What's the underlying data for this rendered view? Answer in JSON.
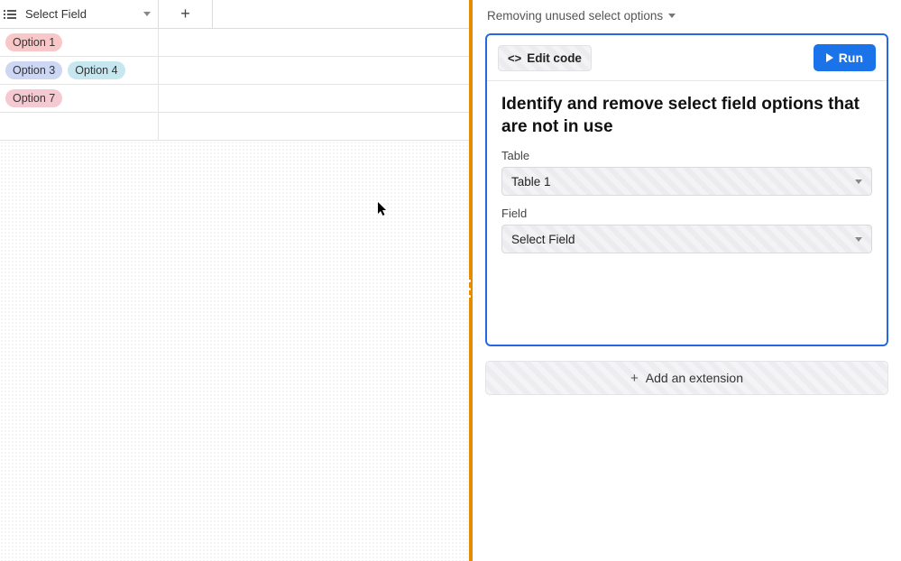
{
  "left": {
    "column_header": "Select Field",
    "rows": [
      {
        "tags": [
          {
            "label": "Option 1",
            "bg": "#f8c7c7"
          }
        ]
      },
      {
        "tags": [
          {
            "label": "Option 3",
            "bg": "#cdd7f3"
          },
          {
            "label": "Option 4",
            "bg": "#c6e7ef"
          }
        ]
      },
      {
        "tags": [
          {
            "label": "Option 7",
            "bg": "#f5c9d2"
          }
        ]
      },
      {
        "tags": []
      }
    ]
  },
  "right": {
    "extension_name": "Removing unused select options",
    "edit_code_label": "Edit code",
    "run_label": "Run",
    "heading": "Identify and remove select field options that are not in use",
    "table_label": "Table",
    "table_value": "Table 1",
    "field_label": "Field",
    "field_value": "Select Field",
    "add_extension_label": "Add an extension"
  },
  "colors": {
    "accent": "#1a73e8",
    "panel_border": "#2668e2",
    "divider": "#e68a00"
  }
}
